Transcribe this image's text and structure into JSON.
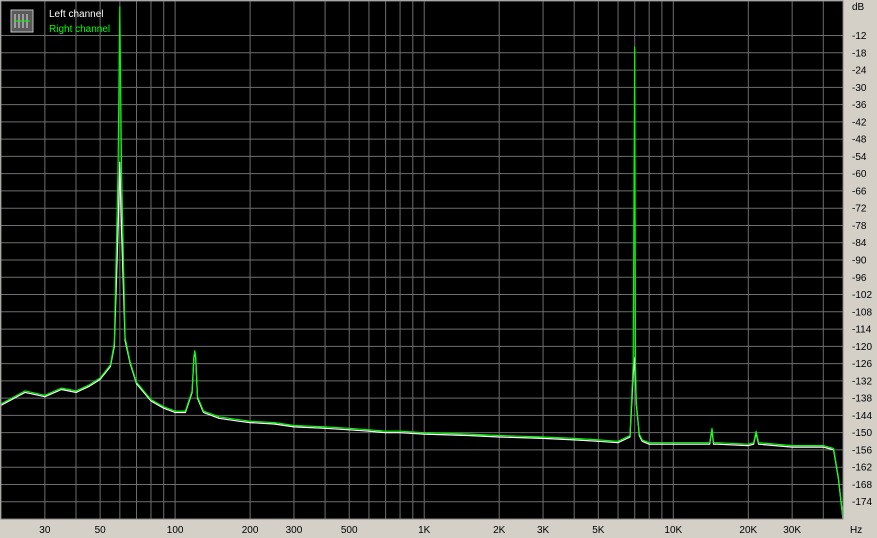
{
  "chart_data": {
    "type": "line",
    "title": "",
    "xlabel": "",
    "ylabel": "",
    "x_unit": "Hz",
    "y_unit": "dB",
    "x_scale": "log",
    "xlim": [
      20,
      48000
    ],
    "ylim": [
      -180,
      0
    ],
    "grid": true,
    "legend_placement": "top-left",
    "y_ticks": [
      -12,
      -18,
      -24,
      -30,
      -36,
      -42,
      -48,
      -54,
      -60,
      -66,
      -72,
      -78,
      -84,
      -90,
      -96,
      -102,
      -108,
      -114,
      -120,
      -126,
      -132,
      -138,
      -144,
      -150,
      -156,
      -162,
      -168,
      -174
    ],
    "x_ticks": [
      {
        "value": 30,
        "label": "30"
      },
      {
        "value": 50,
        "label": "50"
      },
      {
        "value": 100,
        "label": "100"
      },
      {
        "value": 200,
        "label": "200"
      },
      {
        "value": 300,
        "label": "300"
      },
      {
        "value": 500,
        "label": "500"
      },
      {
        "value": 1000,
        "label": "1K"
      },
      {
        "value": 2000,
        "label": "2K"
      },
      {
        "value": 3000,
        "label": "3K"
      },
      {
        "value": 5000,
        "label": "5K"
      },
      {
        "value": 10000,
        "label": "10K"
      },
      {
        "value": 20000,
        "label": "20K"
      },
      {
        "value": 30000,
        "label": "30K"
      }
    ],
    "series": [
      {
        "name": "Left channel",
        "color": "#ffffff",
        "x": [
          20,
          25,
          30,
          35,
          40,
          45,
          50,
          55,
          57,
          59,
          60,
          61,
          63,
          66,
          70,
          80,
          90,
          100,
          110,
          117,
          119,
          120,
          121,
          123,
          130,
          150,
          180,
          200,
          250,
          300,
          400,
          500,
          600,
          700,
          800,
          1000,
          1500,
          2000,
          3000,
          4000,
          5000,
          6000,
          6700,
          6900,
          7000,
          7100,
          7300,
          7500,
          8000,
          10000,
          12000,
          14000,
          14300,
          14500,
          15000,
          20000,
          21000,
          21500,
          22000,
          30000,
          35000,
          40000,
          42000,
          44000,
          46000,
          48000
        ],
        "y": [
          -140.5,
          -136,
          -137.5,
          -135,
          -136,
          -134,
          -131.5,
          -127,
          -120,
          -80,
          -56,
          -80,
          -118,
          -126,
          -133,
          -139,
          -141.5,
          -143,
          -143,
          -136,
          -124,
          -122,
          -124,
          -138,
          -143,
          -145,
          -146,
          -146.5,
          -147,
          -148,
          -148.5,
          -149,
          -149.5,
          -150,
          -150,
          -150.5,
          -151,
          -151.5,
          -152,
          -152.5,
          -153,
          -153.5,
          -151.5,
          -130,
          -124,
          -140,
          -151,
          -153,
          -154,
          -154,
          -154,
          -154,
          -149,
          -154,
          -154,
          -154.5,
          -154,
          -150,
          -154,
          -155,
          -155,
          -155,
          -155.5,
          -156,
          -166,
          -180
        ]
      },
      {
        "name": "Right channel",
        "color": "#00ff00",
        "x": [
          20,
          25,
          30,
          35,
          40,
          45,
          50,
          55,
          57,
          59,
          60,
          61,
          63,
          66,
          70,
          80,
          90,
          100,
          110,
          117,
          119,
          120,
          121,
          123,
          130,
          150,
          180,
          200,
          250,
          300,
          400,
          500,
          600,
          700,
          800,
          1000,
          1500,
          2000,
          3000,
          4000,
          5000,
          6000,
          6700,
          6900,
          7000,
          7050,
          7100,
          7300,
          7500,
          8000,
          10000,
          12000,
          14000,
          14300,
          14500,
          15000,
          20000,
          21000,
          21500,
          22000,
          30000,
          35000,
          40000,
          42000,
          44000,
          46000,
          48000
        ],
        "y": [
          -140,
          -135.5,
          -137,
          -134.5,
          -135.5,
          -133.5,
          -131,
          -126.5,
          -119,
          -60,
          -2,
          -60,
          -117,
          -125.5,
          -132.5,
          -138.5,
          -141,
          -142.5,
          -142.5,
          -135.5,
          -123.5,
          -121.5,
          -123.5,
          -137.5,
          -142.5,
          -144.5,
          -145.5,
          -146,
          -146.5,
          -147.5,
          -148,
          -148.5,
          -149,
          -149.5,
          -149.5,
          -150,
          -150.5,
          -151,
          -151.5,
          -152,
          -152.5,
          -153,
          -151,
          -126,
          -16,
          -126,
          -139.5,
          -150.5,
          -152.5,
          -153.5,
          -153.5,
          -153.5,
          -153.5,
          -148.5,
          -153.5,
          -153.5,
          -154,
          -153.5,
          -149.5,
          -153.5,
          -154.5,
          -154.5,
          -154.5,
          -155,
          -155.5,
          -165.5,
          -180
        ]
      }
    ]
  }
}
